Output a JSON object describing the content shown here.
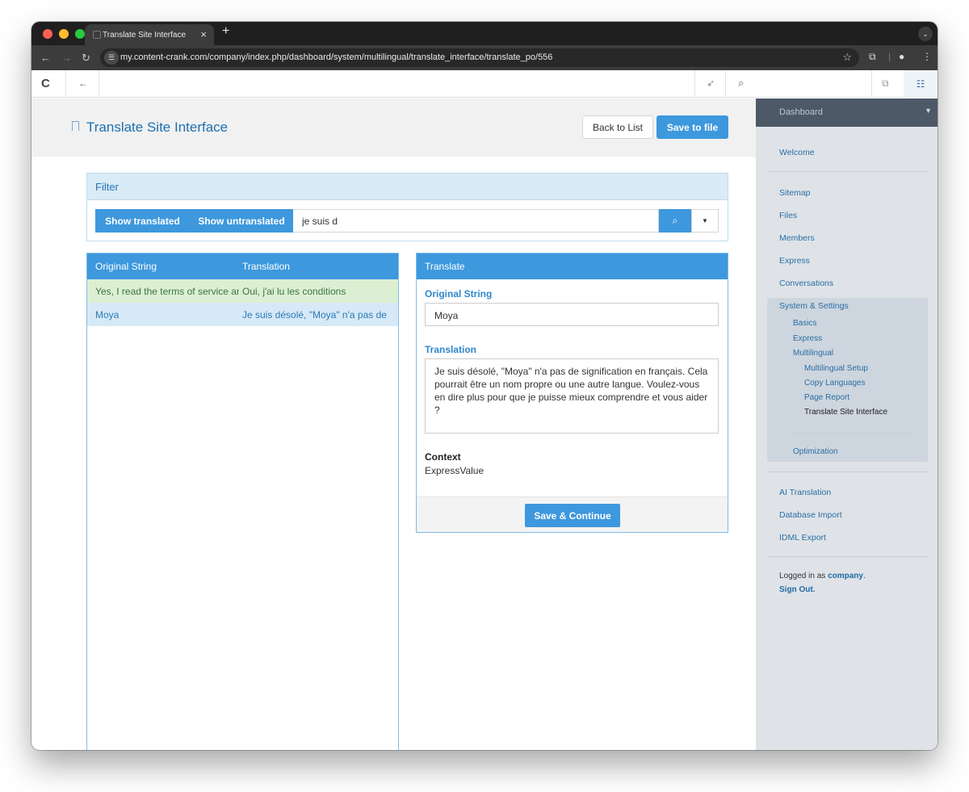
{
  "browser": {
    "tab_title": "Translate Site Interface",
    "tab_close": "×",
    "new_tab": "+",
    "url": "my.content-crank.com/company/index.php/dashboard/system/multilingual/translate_interface/translate_po/556"
  },
  "page": {
    "title": "Translate Site Interface",
    "back_to_list": "Back to List",
    "save_to_file": "Save to file"
  },
  "filter": {
    "heading": "Filter",
    "show_translated": "Show translated",
    "show_untranslated": "Show untranslated",
    "search_value": "je suis d"
  },
  "strings_table": {
    "headers": [
      "Original String",
      "Translation"
    ],
    "rows": [
      {
        "original": "Yes, I read the terms of service and",
        "translation": "Oui, j'ai lu les conditions"
      },
      {
        "original": "Moya",
        "translation": "Je suis désolé, \"Moya\" n'a pas de"
      }
    ]
  },
  "translate_panel": {
    "heading": "Translate",
    "original_label": "Original String",
    "original_value": "Moya",
    "translation_label": "Translation",
    "translation_value": "Je suis désolé, \"Moya\" n'a pas de signification en français. Cela pourrait être un nom propre ou une autre langue. Voulez-vous en dire plus pour que je puisse mieux comprendre et vous aider ?",
    "context_label": "Context",
    "context_value": "ExpressValue",
    "save_continue": "Save & Continue"
  },
  "sidebar": {
    "header": "Dashboard",
    "welcome": "Welcome",
    "items": [
      "Sitemap",
      "Files",
      "Members",
      "Express",
      "Conversations"
    ],
    "system_settings": "System & Settings",
    "system_children": [
      "Basics",
      "Express",
      "Multilingual"
    ],
    "multilingual_children": [
      "Multilingual Setup",
      "Copy Languages",
      "Page Report",
      "Translate Site Interface"
    ],
    "optimization": "Optimization",
    "extras": [
      "AI Translation",
      "Database Import",
      "IDML Export"
    ],
    "logged_in_prefix": "Logged in as",
    "logged_in_user": "company",
    "sign_out": "Sign Out."
  },
  "colors": {
    "accent": "#3d98dd",
    "translated_row": "#dcefd3",
    "selected_row": "#d7e9f6",
    "sidebar_bg": "#dfe3e8"
  }
}
